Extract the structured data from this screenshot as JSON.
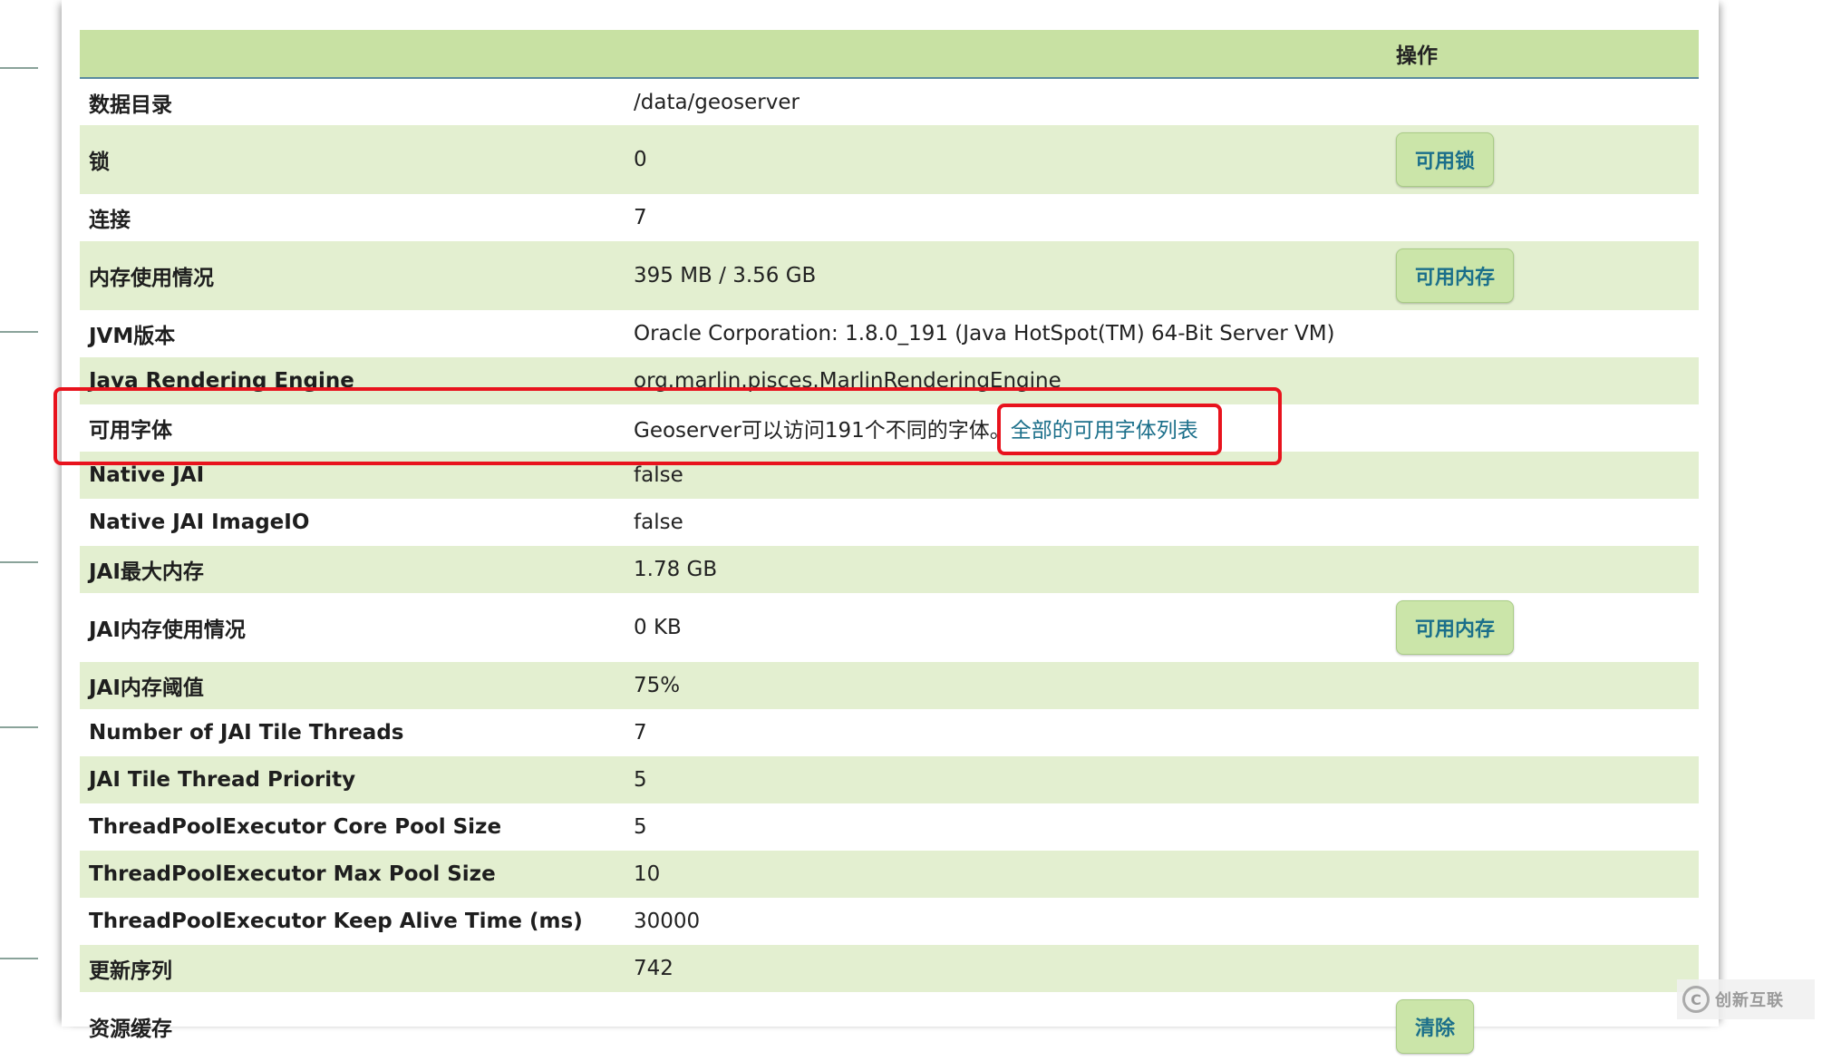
{
  "table": {
    "header": {
      "col1": "",
      "col2": "",
      "col3": "操作"
    },
    "rows": [
      {
        "label": "数据目录",
        "value": "/data/geoserver"
      },
      {
        "label": "锁",
        "value": "0",
        "action": "可用锁"
      },
      {
        "label": "连接",
        "value": "7"
      },
      {
        "label": "内存使用情况",
        "value": "395 MB / 3.56 GB",
        "action": "可用内存"
      },
      {
        "label": "JVM版本",
        "value": "Oracle Corporation: 1.8.0_191 (Java HotSpot(TM) 64-Bit Server VM)"
      },
      {
        "label": "Java Rendering Engine",
        "value": "org.marlin.pisces.MarlinRenderingEngine"
      },
      {
        "label": "可用字体",
        "value": "Geoserver可以访问191个不同的字体。",
        "link": "全部的可用字体列表"
      },
      {
        "label": "Native JAI",
        "value": "false"
      },
      {
        "label": "Native JAI ImageIO",
        "value": "false"
      },
      {
        "label": "JAI最大内存",
        "value": "1.78 GB"
      },
      {
        "label": "JAI内存使用情况",
        "value": "0 KB",
        "action": "可用内存"
      },
      {
        "label": "JAI内存阈值",
        "value": "75%"
      },
      {
        "label": "Number of JAI Tile Threads",
        "value": "7"
      },
      {
        "label": "JAI Tile Thread Priority",
        "value": "5"
      },
      {
        "label": "ThreadPoolExecutor Core Pool Size",
        "value": "5"
      },
      {
        "label": "ThreadPoolExecutor Max Pool Size",
        "value": "10"
      },
      {
        "label": "ThreadPoolExecutor Keep Alive Time (ms)",
        "value": "30000"
      },
      {
        "label": "更新序列",
        "value": "742"
      },
      {
        "label": "资源缓存",
        "value": "",
        "action": "清除"
      }
    ]
  },
  "watermark": {
    "logo": "C",
    "text": "创新互联"
  },
  "colors": {
    "header_bg": "#c8e1a3",
    "alt_row_bg": "#e3efd0",
    "button_bg": "#cbe5a9",
    "link": "#1b6f8a",
    "highlight": "#e8131d"
  }
}
